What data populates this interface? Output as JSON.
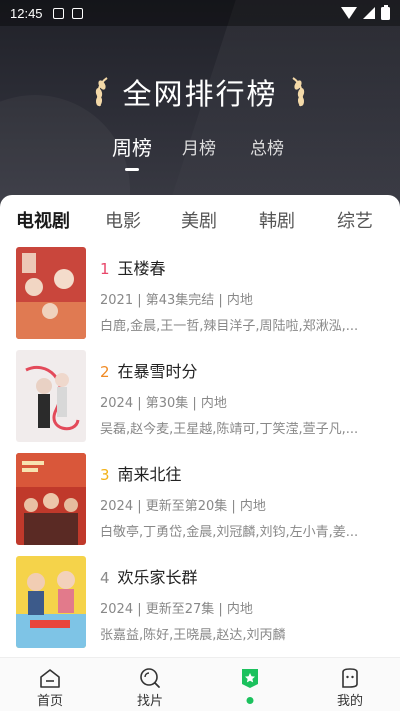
{
  "status_bar": {
    "time": "12:45"
  },
  "header": {
    "title": "全网排行榜"
  },
  "period_tabs": [
    {
      "label": "周榜",
      "active": true
    },
    {
      "label": "月榜",
      "active": false
    },
    {
      "label": "总榜",
      "active": false
    }
  ],
  "category_tabs": [
    {
      "label": "电视剧",
      "active": true
    },
    {
      "label": "电影",
      "active": false
    },
    {
      "label": "美剧",
      "active": false
    },
    {
      "label": "韩剧",
      "active": false
    },
    {
      "label": "综艺",
      "active": false
    }
  ],
  "shows": [
    {
      "rank": "1",
      "rank_color": "#e8476a",
      "title": "玉楼春",
      "meta": "2021 | 第43集完结 | 内地",
      "cast": "白鹿,金晨,王一哲,辣目洋子,周陆啦,郑湫泓,..."
    },
    {
      "rank": "2",
      "rank_color": "#f08a24",
      "title": "在暴雪时分",
      "meta": "2024 | 第30集 | 内地",
      "cast": "吴磊,赵今麦,王星越,陈靖可,丁笑滢,萱子凡,..."
    },
    {
      "rank": "3",
      "rank_color": "#f2b21a",
      "title": "南来北往",
      "meta": "2024 | 更新至第20集 | 内地",
      "cast": "白敬亭,丁勇岱,金晨,刘冠麟,刘钧,左小青,姜..."
    },
    {
      "rank": "4",
      "rank_color": "#8a8a8a",
      "title": "欢乐家长群",
      "meta": "2024 | 更新至27集 | 内地",
      "cast": "张嘉益,陈好,王晓晨,赵达,刘丙麟"
    }
  ],
  "bottom_nav": [
    {
      "label": "首页",
      "icon": "home-icon"
    },
    {
      "label": "找片",
      "icon": "search-film-icon"
    },
    {
      "label": "",
      "icon": "ranking-icon",
      "active": true
    },
    {
      "label": "我的",
      "icon": "profile-icon"
    }
  ],
  "colors": {
    "accent": "#1bc15d",
    "hero_bg": "#24252d"
  }
}
